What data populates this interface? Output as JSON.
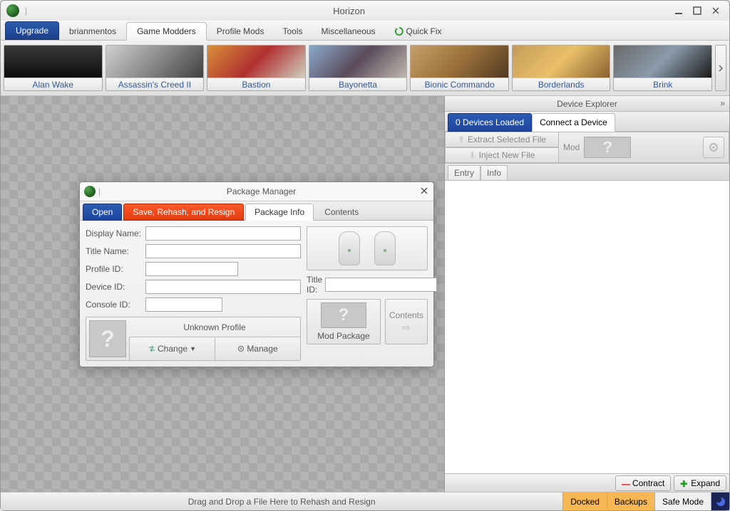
{
  "app": {
    "title": "Horizon"
  },
  "main_tabs": {
    "upgrade": "Upgrade",
    "user": "brianmentos",
    "modders": "Game Modders",
    "profile": "Profile Mods",
    "tools": "Tools",
    "misc": "Miscellaneous",
    "quickfix": "Quick Fix"
  },
  "games": [
    {
      "label": "Alan Wake"
    },
    {
      "label": "Assassin's Creed II"
    },
    {
      "label": "Bastion"
    },
    {
      "label": "Bayonetta"
    },
    {
      "label": "Bionic Commando"
    },
    {
      "label": "Borderlands"
    },
    {
      "label": "Brink"
    }
  ],
  "explorer": {
    "title": "Device Explorer",
    "loaded": "0 Devices Loaded",
    "connect": "Connect a Device",
    "extract": "Extract Selected File",
    "inject": "Inject New File",
    "mod": "Mod",
    "entry": "Entry",
    "info": "Info",
    "contract": "Contract",
    "expand": "Expand"
  },
  "footer": {
    "hint": "Drag and Drop a File Here to Rehash and Resign",
    "docked": "Docked",
    "backups": "Backups",
    "safemode": "Safe Mode"
  },
  "pkg": {
    "title": "Package Manager",
    "tabs": {
      "open": "Open",
      "save": "Save, Rehash, and Resign",
      "info": "Package Info",
      "contents": "Contents"
    },
    "fields": {
      "display_name": "Display Name:",
      "title_name": "Title Name:",
      "profile_id": "Profile ID:",
      "device_id": "Device ID:",
      "console_id": "Console ID:",
      "title_id": "Title ID:"
    },
    "values": {
      "display_name": "",
      "title_name": "",
      "profile_id": "",
      "device_id": "",
      "console_id": "",
      "title_id": ""
    },
    "profile": {
      "name": "Unknown Profile",
      "change": "Change",
      "manage": "Manage"
    },
    "mod_package": "Mod Package",
    "contents_btn": "Contents"
  }
}
